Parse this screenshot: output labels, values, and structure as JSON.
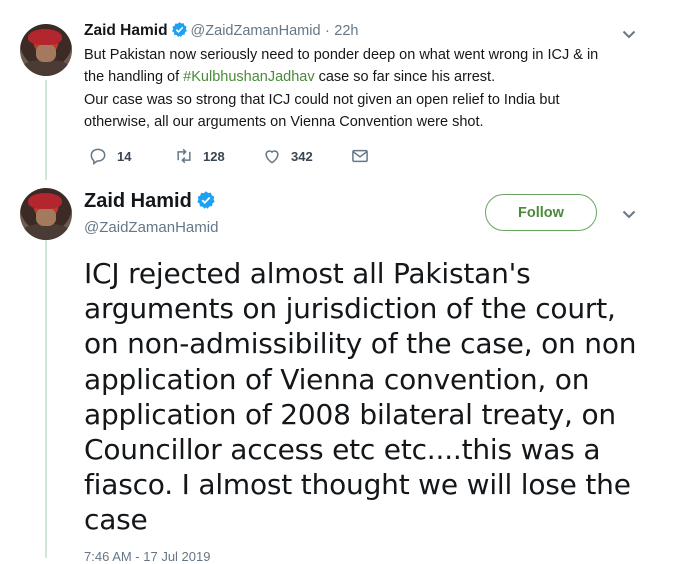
{
  "tweet1": {
    "name": "Zaid Hamid",
    "handle": "@ZaidZamanHamid",
    "separator": "·",
    "time": "22h",
    "line1": "But Pakistan now seriously need to ponder deep on what went wrong in ICJ & in",
    "line2_prefix": "the handling of ",
    "hashtag": "#KulbhushanJadhav",
    "line2_suffix": " case so far since his arrest.",
    "line3": "Our case was so strong that ICJ could not given an open relief to India but",
    "line4": "otherwise, all our arguments on Vienna Convention were shot.",
    "actions": {
      "replies": "14",
      "retweets": "128",
      "likes": "342"
    }
  },
  "tweet2": {
    "name": "Zaid Hamid",
    "handle": "@ZaidZamanHamid",
    "follow_label": "Follow",
    "lines": [
      "ICJ rejected almost all Pakistan's",
      "arguments on jurisdiction of the court,",
      "on non-admissibility of the case, on non",
      "application of Vienna convention, on",
      "application of 2008 bilateral treaty, on",
      "Councillor access etc etc....this was a",
      "fiasco. I almost thought we will lose the",
      "case"
    ],
    "timestamp": "7:46 AM - 17 Jul 2019"
  },
  "colors": {
    "accent": "#4a8a3a",
    "verified": "#1da1f2",
    "thread_line": "#cfe7d6"
  },
  "icons": [
    "verified-badge-icon",
    "chevron-down-icon",
    "reply-icon",
    "retweet-icon",
    "like-icon",
    "message-icon"
  ]
}
